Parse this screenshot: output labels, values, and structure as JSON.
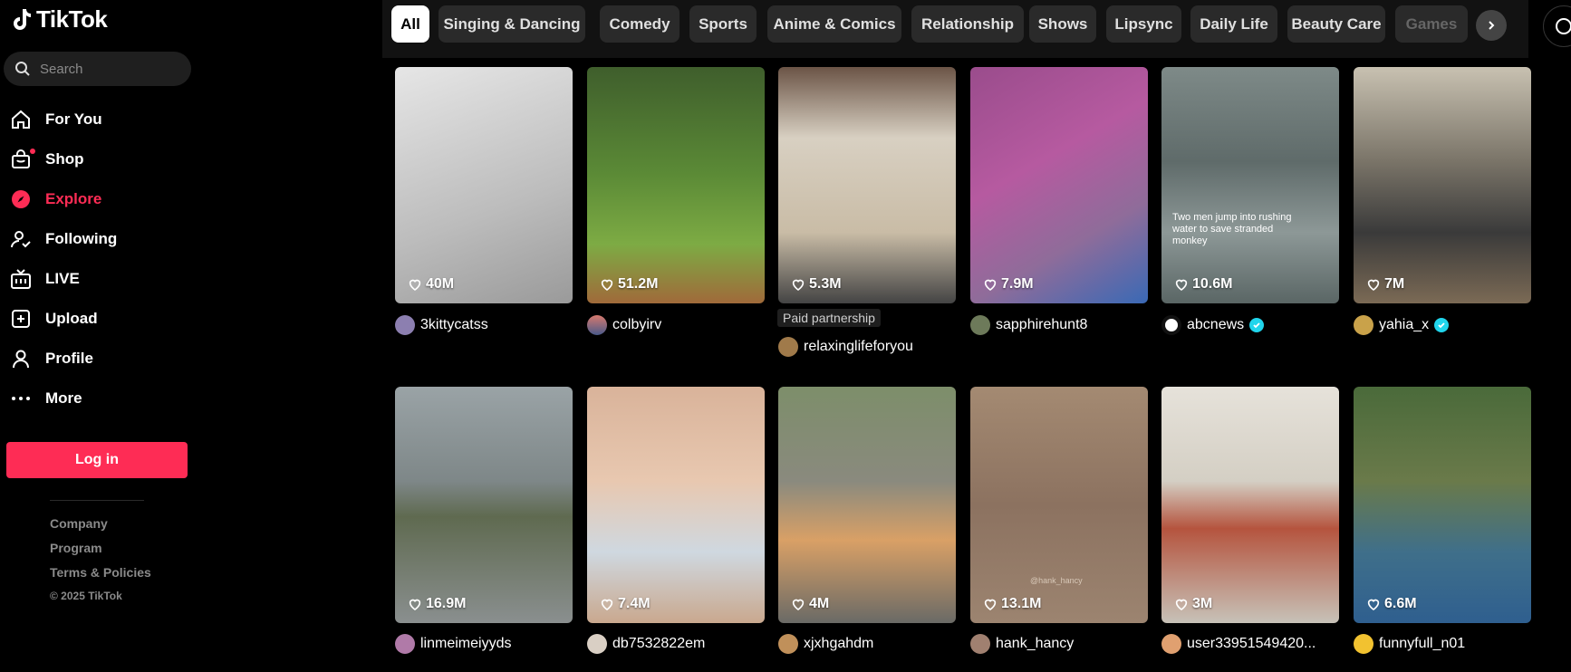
{
  "app": {
    "logo_text": "TikTok"
  },
  "search": {
    "placeholder": "Search"
  },
  "nav": [
    {
      "label": "For You",
      "icon": "home-icon"
    },
    {
      "label": "Shop",
      "icon": "shop-icon"
    },
    {
      "label": "Explore",
      "icon": "compass-icon"
    },
    {
      "label": "Following",
      "icon": "following-icon"
    },
    {
      "label": "LIVE",
      "icon": "live-icon"
    },
    {
      "label": "Upload",
      "icon": "upload-icon"
    },
    {
      "label": "Profile",
      "icon": "profile-icon"
    },
    {
      "label": "More",
      "icon": "more-icon"
    }
  ],
  "login_label": "Log in",
  "footer": {
    "company": "Company",
    "program": "Program",
    "terms": "Terms & Policies",
    "copyright": "© 2025 TikTok"
  },
  "categories": [
    "All",
    "Singing & Dancing",
    "Comedy",
    "Sports",
    "Anime & Comics",
    "Relationship",
    "Shows",
    "Lipsync",
    "Daily Life",
    "Beauty Care",
    "Games"
  ],
  "paid_label": "Paid partnership",
  "videos": [
    {
      "likes": "40M",
      "user": "3kittycatss",
      "verified": false
    },
    {
      "likes": "51.2M",
      "user": "colbyirv",
      "verified": false
    },
    {
      "likes": "5.3M",
      "user": "relaxinglifeforyou",
      "verified": false
    },
    {
      "likes": "7.9M",
      "user": "sapphirehunt8",
      "verified": false
    },
    {
      "likes": "10.6M",
      "user": "abcnews",
      "verified": true,
      "overlay": "Two men jump into rushing water to save stranded monkey"
    },
    {
      "likes": "7M",
      "user": "yahia_x",
      "verified": true
    },
    {
      "likes": "16.9M",
      "user": "linmeimeiyyds",
      "verified": false
    },
    {
      "likes": "7.4M",
      "user": "db7532822em",
      "verified": false
    },
    {
      "likes": "4M",
      "user": "xjxhgahdm",
      "verified": false
    },
    {
      "likes": "13.1M",
      "user": "hank_hancy",
      "verified": false,
      "overlay": "@hank_hancy"
    },
    {
      "likes": "3M",
      "user": "user33951549420...",
      "verified": false
    },
    {
      "likes": "6.6M",
      "user": "funnyfull_n01",
      "verified": false
    }
  ],
  "colors": {
    "accent": "#fe2c55",
    "verified": "#20d5ec"
  }
}
